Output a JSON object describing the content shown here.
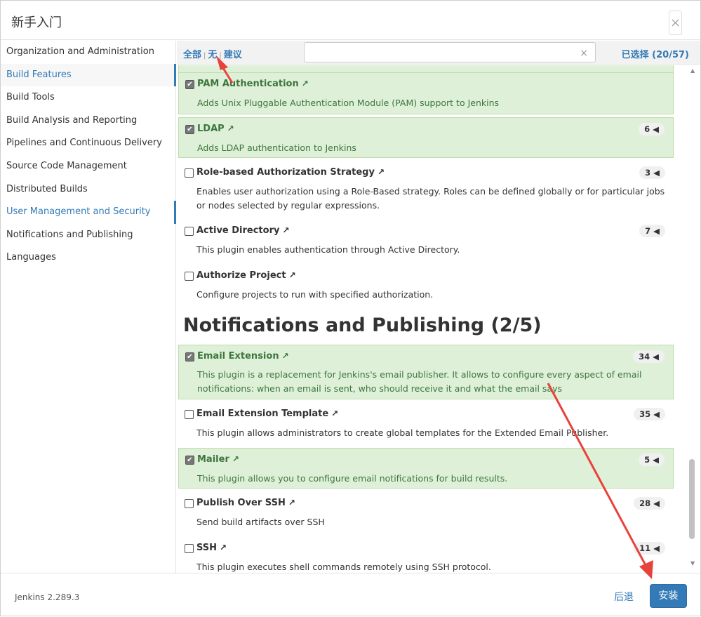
{
  "dialog": {
    "title": "新手入门",
    "close_label": "×"
  },
  "sidebar": {
    "items": [
      {
        "label": "Organization and Administration"
      },
      {
        "label": "Build Features"
      },
      {
        "label": "Build Tools"
      },
      {
        "label": "Build Analysis and Reporting"
      },
      {
        "label": "Pipelines and Continuous Delivery"
      },
      {
        "label": "Source Code Management"
      },
      {
        "label": "Distributed Builds"
      },
      {
        "label": "User Management and Security"
      },
      {
        "label": "Notifications and Publishing"
      },
      {
        "label": "Languages"
      }
    ]
  },
  "toolbar": {
    "all_label": "全部",
    "none_label": "无",
    "suggested_label": "建议",
    "search_placeholder": "",
    "clear_label": "×",
    "selected_label": "已选择 (20/57)"
  },
  "plugins_security": [
    {
      "name": "PAM Authentication",
      "desc": "Adds Unix Pluggable Authentication Module (PAM) support to Jenkins",
      "selected": true,
      "deps": ""
    },
    {
      "name": "LDAP",
      "desc": "Adds LDAP authentication to Jenkins",
      "selected": true,
      "deps": "6"
    },
    {
      "name": "Role-based Authorization Strategy",
      "desc": "Enables user authorization using a Role-Based strategy. Roles can be defined globally or for particular jobs or nodes selected by regular expressions.",
      "selected": false,
      "deps": "3"
    },
    {
      "name": "Active Directory",
      "desc": "This plugin enables authentication through Active Directory.",
      "selected": false,
      "deps": "7"
    },
    {
      "name": "Authorize Project",
      "desc": "Configure projects to run with specified authorization.",
      "selected": false,
      "deps": ""
    }
  ],
  "section_notifications": {
    "title": "Notifications and Publishing (2/5)"
  },
  "plugins_notifications": [
    {
      "name": "Email Extension",
      "desc": "This plugin is a replacement for Jenkins's email publisher. It allows to configure every aspect of email notifications: when an email is sent, who should receive it and what the email says",
      "selected": true,
      "deps": "34"
    },
    {
      "name": "Email Extension Template",
      "desc": "This plugin allows administrators to create global templates for the Extended Email Publisher.",
      "selected": false,
      "deps": "35"
    },
    {
      "name": "Mailer",
      "desc": "This plugin allows you to configure email notifications for build results.",
      "selected": true,
      "deps": "5"
    },
    {
      "name": "Publish Over SSH",
      "desc": "Send build artifacts over SSH",
      "selected": false,
      "deps": "28"
    },
    {
      "name": "SSH",
      "desc": "This plugin executes shell commands remotely using SSH protocol.",
      "selected": false,
      "deps": "11"
    }
  ],
  "footer": {
    "version": "Jenkins 2.289.3",
    "back_label": "后退",
    "install_label": "安装"
  },
  "colors": {
    "accent": "#337ab7",
    "selected_bg": "#dff0d8",
    "selected_text": "#3c763d",
    "annotation_arrow": "#e8423c"
  },
  "icons": {
    "external_link": "↗",
    "checkmark": "✔",
    "dependency_caret": "◀"
  }
}
